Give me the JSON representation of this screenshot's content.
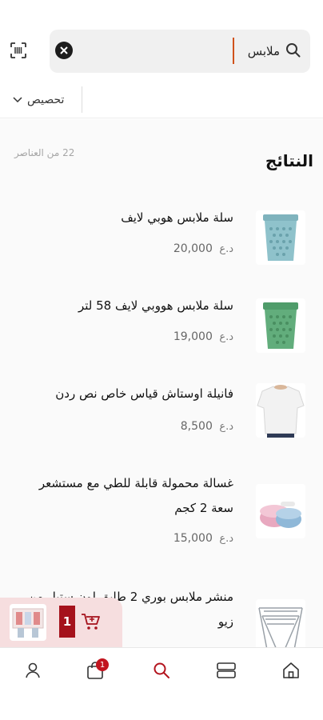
{
  "search": {
    "query": "ملابس"
  },
  "filter": {
    "label": "تحصيص"
  },
  "results": {
    "title": "النتائج",
    "count_label": "22 من العناصر"
  },
  "products": [
    {
      "name": "سلة ملابس هوبي لايف",
      "price": "20,000",
      "currency": "د.ع",
      "image": "laundry-basket-blue"
    },
    {
      "name": "سلة ملابس هووبي لايف 58 لتر",
      "price": "19,000",
      "currency": "د.ع",
      "image": "laundry-basket-green"
    },
    {
      "name": "فانيلة اوستاش قياس خاص نص ردن",
      "price": "8,500",
      "currency": "د.ع",
      "image": "white-tshirt"
    },
    {
      "name": "غسالة محمولة قابلة للطي مع مستشعر سعة 2 كجم",
      "price": "15,000",
      "currency": "د.ع",
      "image": "portable-washer"
    },
    {
      "name": "منشر ملابس بوري 2 طابق لون ستيل من زيو",
      "price": "",
      "currency": "",
      "image": "clothes-rack"
    }
  ],
  "cart_float": {
    "quantity": "1"
  },
  "bottom_nav": {
    "cart_badge": "1",
    "items": [
      "home-icon",
      "categories-icon",
      "search-icon",
      "cart-icon",
      "profile-icon"
    ],
    "active_color": "#b3141e"
  }
}
